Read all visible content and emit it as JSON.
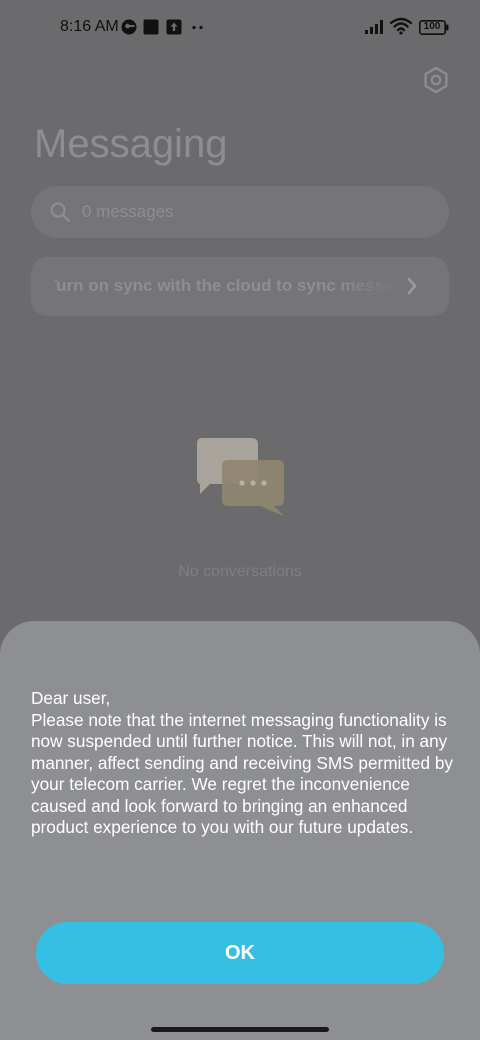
{
  "status_bar": {
    "time": "8:16 AM",
    "battery_level": "100",
    "icons": [
      "vpn-key-icon",
      "app-notification-icon",
      "upload-notification-icon",
      "more-notifications-icon",
      "signal-icon",
      "wifi-icon",
      "battery-icon"
    ]
  },
  "header": {
    "title": "Messaging",
    "settings_icon": "gear-icon"
  },
  "search": {
    "placeholder": "0 messages",
    "icon": "search-icon"
  },
  "sync_banner": {
    "text": "Turn on sync with the cloud to sync messages",
    "icon": "chevron-right-icon"
  },
  "empty_state": {
    "icon": "chat-bubbles-icon",
    "text": "No conversations"
  },
  "dialog": {
    "message": "Dear user,\nPlease note that the internet messaging functionality is now suspended until further notice. This will not, in any manner, affect sending and receiving SMS permitted by your telecom carrier. We regret the inconvenience caused and look forward to bringing an enhanced product experience to you with our future updates.",
    "ok_label": "OK"
  },
  "colors": {
    "overlay_background": "#6b6b6d",
    "sheet_background": "#8e8f93",
    "accent": "#36bfe4"
  }
}
